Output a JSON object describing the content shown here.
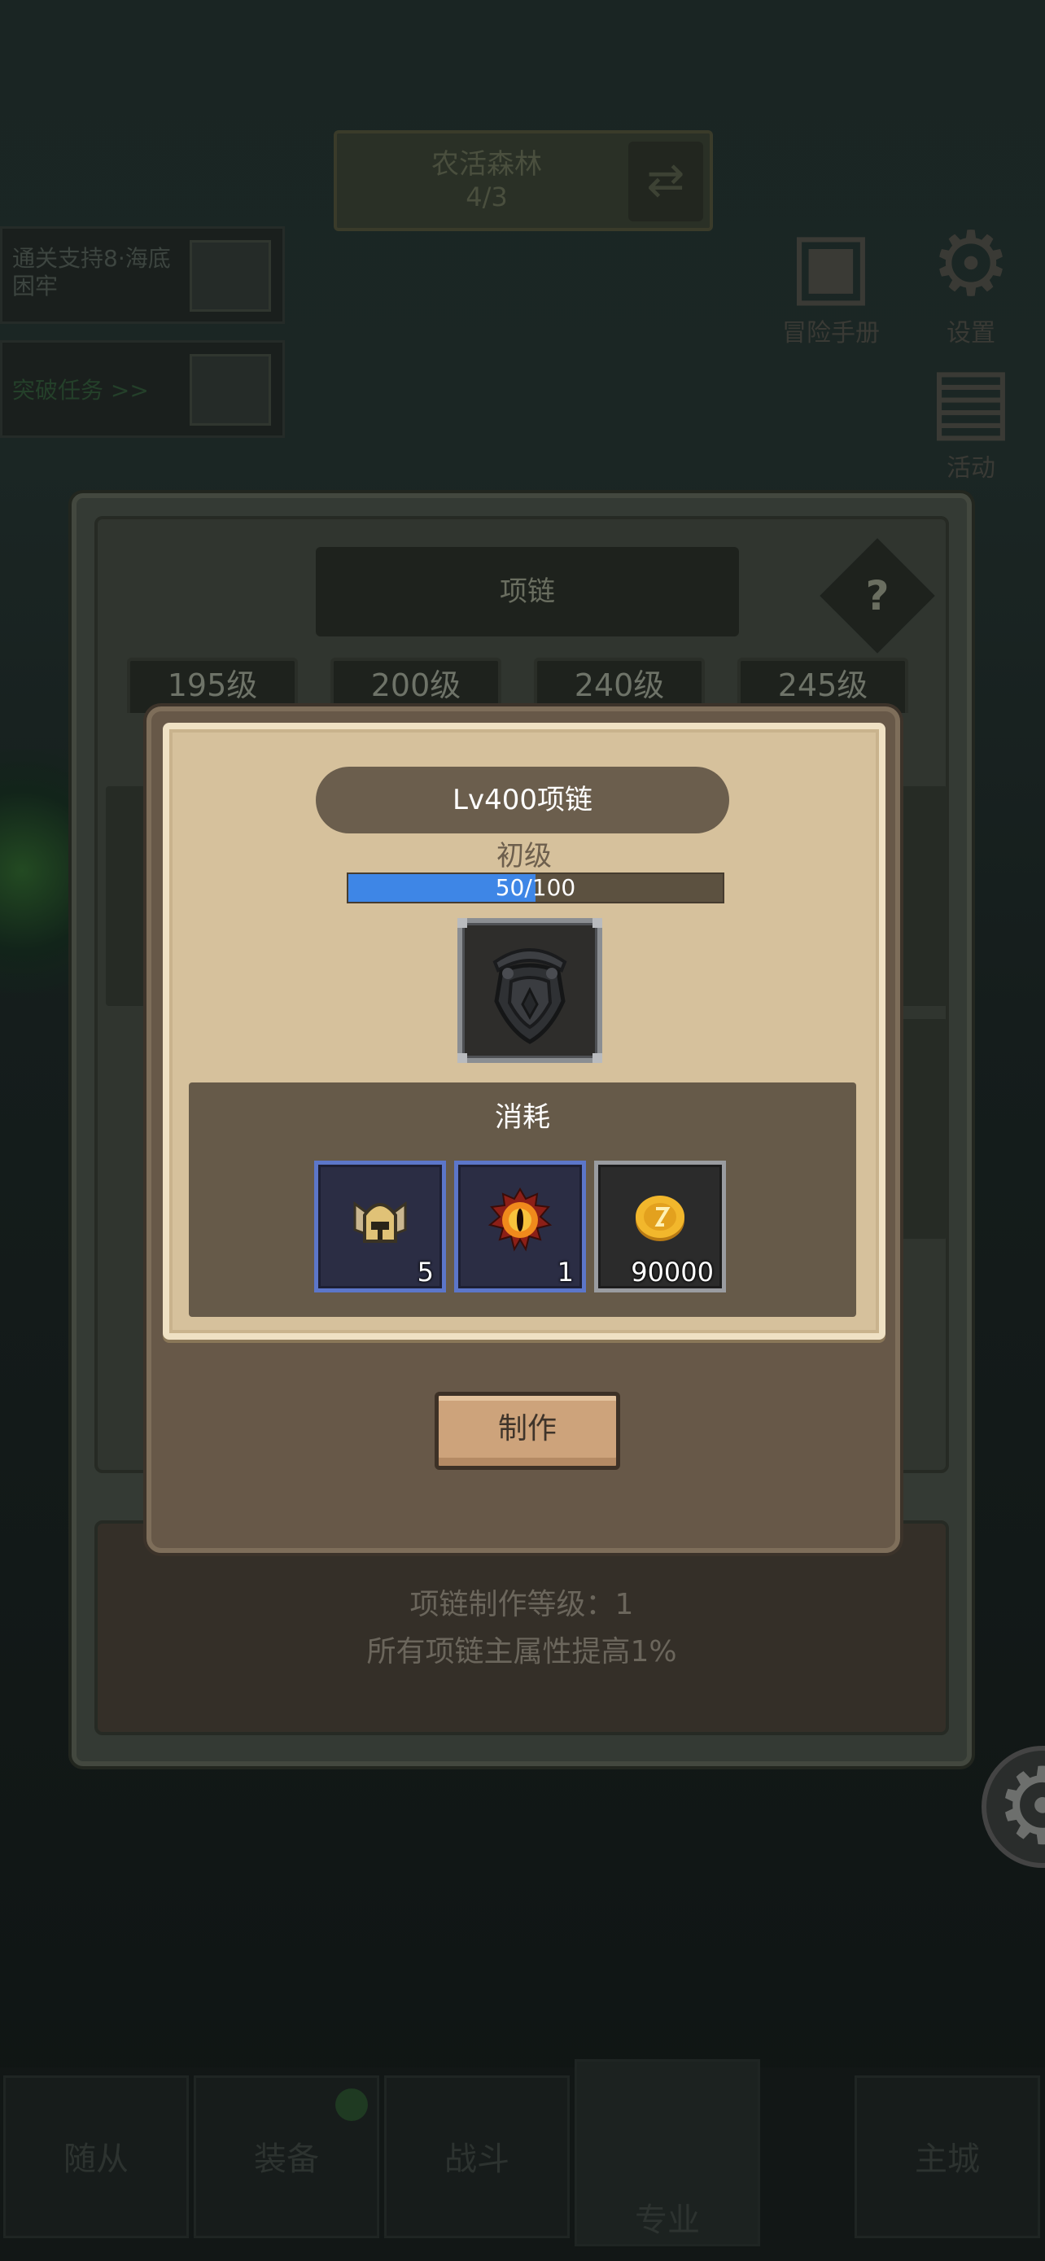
{
  "hud": {
    "title": "农活森林",
    "title_sub": "4/3",
    "left_panels": [
      {
        "text": "通关支持8·海底困牢"
      },
      {
        "text": "突破任务 >>"
      }
    ],
    "right_icons": [
      {
        "label": "冒险手册",
        "icon": "book-icon"
      },
      {
        "label": "设置",
        "icon": "gear-icon"
      },
      {
        "label": "活动",
        "icon": "scroll-icon"
      }
    ]
  },
  "bottom_nav": {
    "tabs": [
      {
        "label": "随从"
      },
      {
        "label": "装备"
      },
      {
        "label": "战斗"
      },
      {
        "label": "专业"
      },
      {
        "label": "主城"
      }
    ]
  },
  "profession_panel": {
    "title": "项链",
    "help_label": "?",
    "level_tabs": [
      "195级",
      "200级",
      "240级",
      "245级"
    ],
    "craft_level_text": "项链制作等级：1",
    "bonus_text": "所有项链主属性提高1%"
  },
  "craft_popup": {
    "item_name": "Lv400项链",
    "grade": "初级",
    "progress": {
      "current": 50,
      "max": 100,
      "text": "50/100"
    },
    "item_icon": "necklace-icon",
    "cost_title": "消耗",
    "costs": [
      {
        "icon": "helmet-icon",
        "count": "5"
      },
      {
        "icon": "demon-eye-icon",
        "count": "1"
      },
      {
        "icon": "gold-coin-icon",
        "count": "90000"
      }
    ],
    "make_button": "制作"
  },
  "colors": {
    "progress_fill": "#3e86e6",
    "popup_paper": "#d6c19c",
    "button_wood": "#cda37b"
  }
}
